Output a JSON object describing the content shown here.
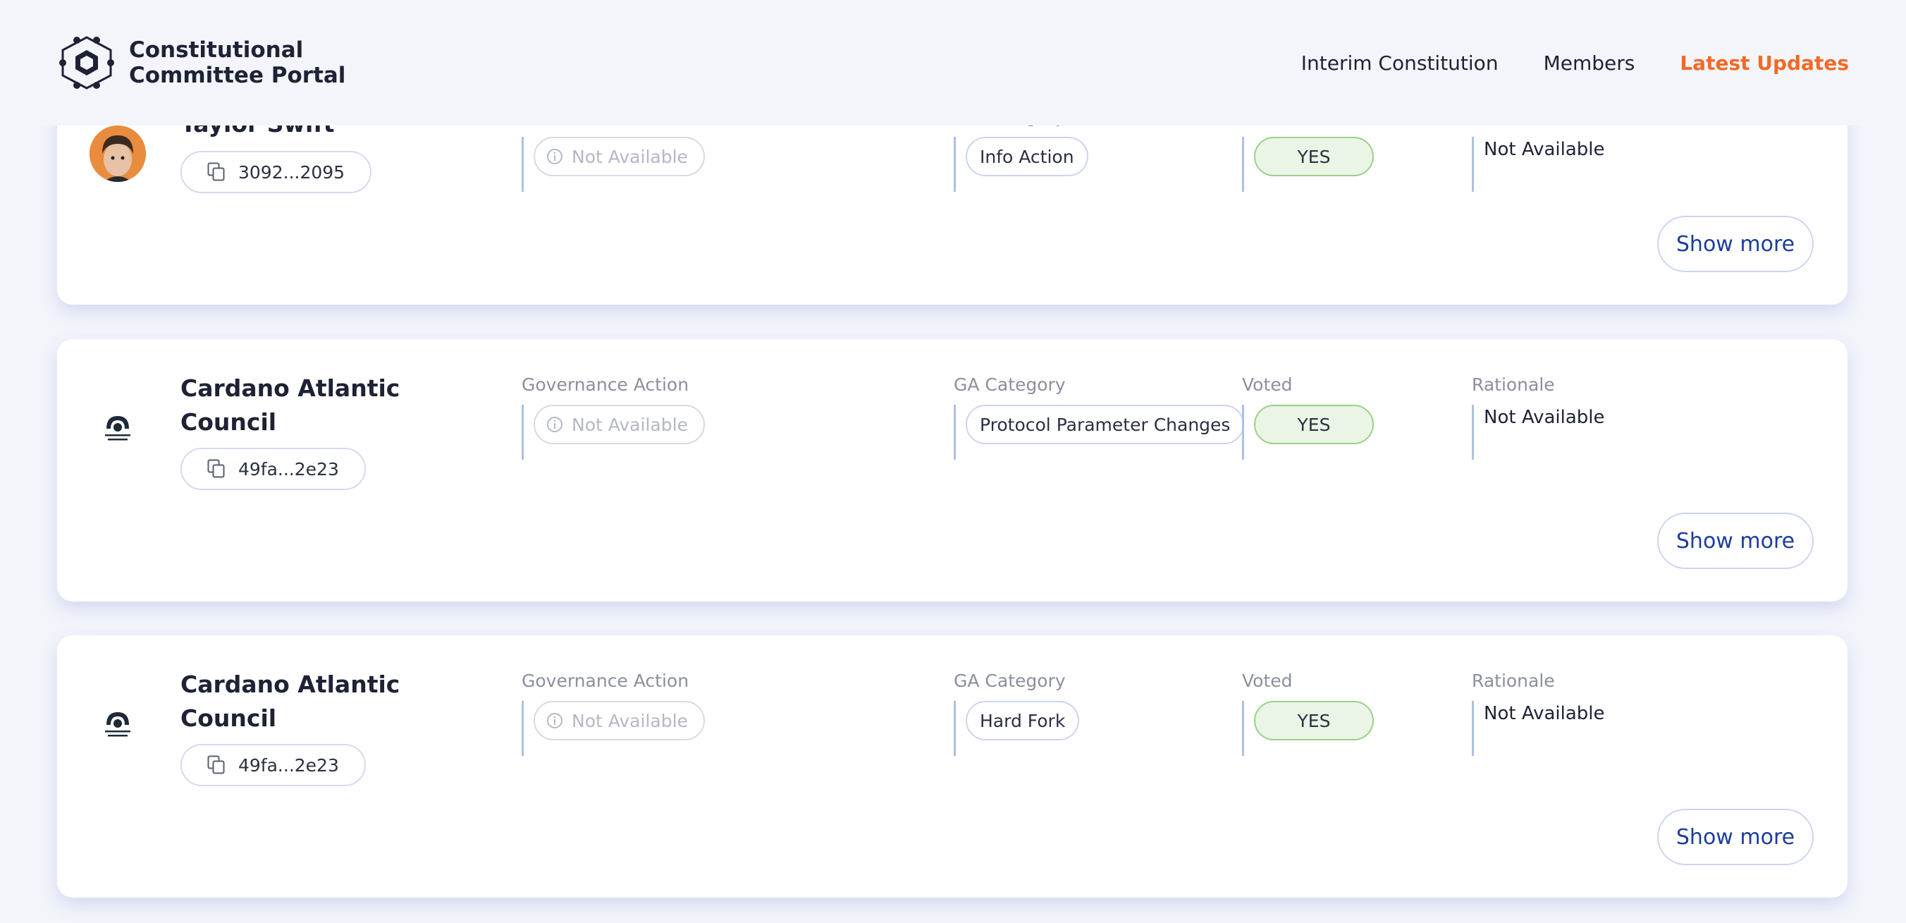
{
  "header": {
    "title_line1": "Constitutional",
    "title_line2": "Committee Portal",
    "nav": [
      {
        "label": "Interim Constitution",
        "active": false
      },
      {
        "label": "Members",
        "active": false
      },
      {
        "label": "Latest Updates",
        "active": true
      }
    ]
  },
  "column_labels": {
    "governance_action": "Governance Action",
    "ga_category": "GA Category",
    "voted": "Voted",
    "rationale": "Rationale"
  },
  "cards": [
    {
      "name": "Taylor Swift",
      "avatar": "person-photo",
      "id": "3092...2095",
      "governance_action": "Not Available",
      "ga_category": "Info Action",
      "voted": "YES",
      "rationale": "Not Available",
      "show_more": "Show more"
    },
    {
      "name": "Cardano Atlantic Council",
      "avatar": "council-logo",
      "id": "49fa...2e23",
      "governance_action": "Not Available",
      "ga_category": "Protocol Parameter Changes",
      "voted": "YES",
      "rationale": "Not Available",
      "show_more": "Show more"
    },
    {
      "name": "Cardano Atlantic Council",
      "avatar": "council-logo",
      "id": "49fa...2e23",
      "governance_action": "Not Available",
      "ga_category": "Hard Fork",
      "voted": "YES",
      "rationale": "Not Available",
      "show_more": "Show more"
    }
  ],
  "colors": {
    "accent": "#f06a26",
    "link": "#1c3d9c",
    "yes_bg": "#eaf5e6",
    "yes_border": "#9ad08a"
  }
}
